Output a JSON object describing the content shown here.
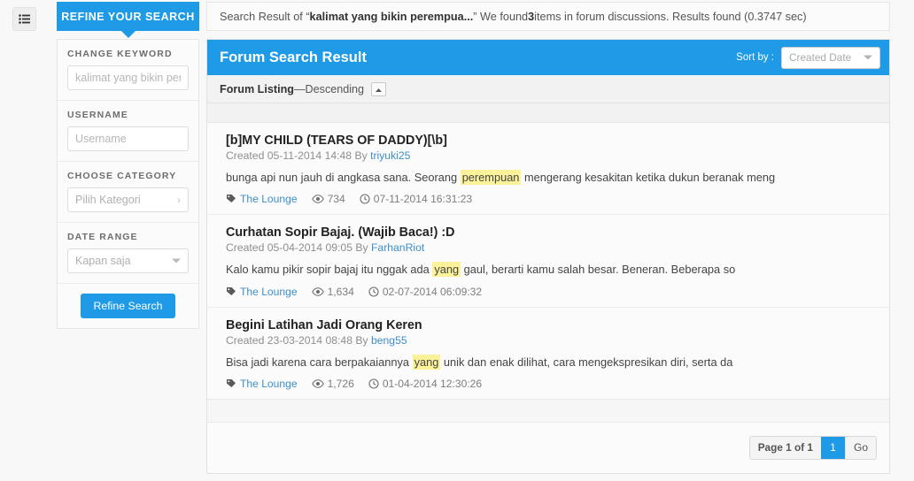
{
  "rail": {
    "menu_icon": "list-menu-icon"
  },
  "refine_tab": {
    "label": "REFINE YOUR SEARCH"
  },
  "summary": {
    "prefix": "Search Result of “",
    "query": "kalimat yang bikin perempua...",
    "mid": "” We found ",
    "count": "3",
    "suffix": " items in forum discussions. Results found (0.3747 sec)"
  },
  "sidebar": {
    "groups": [
      {
        "label": "CHANGE KEYWORD",
        "placeholder": "kalimat yang bikin perempuan",
        "value": "",
        "type": "text"
      },
      {
        "label": "USERNAME",
        "placeholder": "Username",
        "value": "",
        "type": "text"
      },
      {
        "label": "CHOOSE CATEGORY",
        "placeholder": "Pilih Kategori",
        "value": "Pilih Kategori",
        "type": "chevron"
      },
      {
        "label": "DATE RANGE",
        "placeholder": "Kapan saja",
        "value": "Kapan saja",
        "type": "caret"
      }
    ],
    "submit_label": "Refine Search"
  },
  "content": {
    "title": "Forum Search Result",
    "sort_by_label": "Sort by :",
    "sort_value": "Created Date",
    "sort_options": [
      "Created Date"
    ],
    "listing_label": "Forum Listing",
    "listing_dash": " — ",
    "listing_order": "Descending",
    "sort_toggle_icon": "chevron-up-icon"
  },
  "results": [
    {
      "title": "[b]MY CHILD (TEARS OF DADDY)[\\b]",
      "created_prefix": "Created 05-11-2014 14:48 By ",
      "author": "triyuki25",
      "snippet_before": "bunga api nun jauh di angkasa sana. Seorang ",
      "highlight": "perempuan",
      "snippet_after": " mengerang kesakitan ketika dukun beranak meng",
      "category": "The Lounge",
      "views": "734",
      "date": "07-11-2014 16:31:23"
    },
    {
      "title": "Curhatan Sopir Bajaj. (Wajib Baca!) :D",
      "created_prefix": "Created 05-04-2014 09:05 By ",
      "author": "FarhanRiot",
      "snippet_before": "Kalo kamu pikir sopir bajaj itu nggak ada ",
      "highlight": "yang",
      "snippet_after": " gaul, berarti kamu salah besar. Beneran. Beberapa so",
      "category": "The Lounge",
      "views": "1,634",
      "date": "02-07-2014 06:09:32"
    },
    {
      "title": "Begini Latihan Jadi Orang Keren",
      "created_prefix": "Created 23-03-2014 08:48 By ",
      "author": "beng55",
      "snippet_before": "Bisa jadi karena cara berpakaiannya ",
      "highlight": "yang",
      "snippet_after": " unik dan enak dilihat, cara mengekspresikan diri, serta da",
      "category": "The Lounge",
      "views": "1,726",
      "date": "01-04-2014 12:30:26"
    }
  ],
  "pager": {
    "info": "Page 1 of 1",
    "current": "1",
    "go_label": "Go"
  },
  "colors": {
    "accent": "#1e9ae6",
    "link": "#3d8fc9",
    "highlight": "#fbf29a"
  }
}
